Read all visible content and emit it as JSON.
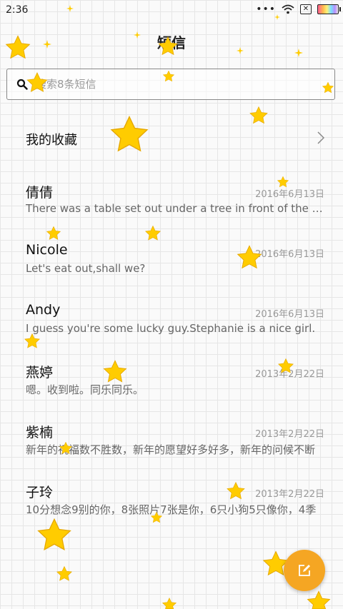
{
  "status_bar": {
    "time": "2:36"
  },
  "title": "短信",
  "search": {
    "placeholder": "搜索8条短信"
  },
  "favorites": {
    "label": "我的收藏"
  },
  "messages": [
    {
      "name": "倩倩",
      "date": "2016年6月13日",
      "preview": "There was a table set out under a tree in front of the house"
    },
    {
      "name": "Nicole",
      "date": "2016年6月13日",
      "preview": "Let's eat out,shall we?"
    },
    {
      "name": "Andy",
      "date": "2016年6月13日",
      "preview": "I guess you're some lucky guy.Stephanie is a nice girl."
    },
    {
      "name": "燕婷",
      "date": "2013年2月22日",
      "preview": "嗯。收到啦。同乐同乐。"
    },
    {
      "name": "紫楠",
      "date": "2013年2月22日",
      "preview": "新年的祝福数不胜数，新年的愿望好多好多，新年的问候不断"
    },
    {
      "name": "子玲",
      "date": "2013年2月22日",
      "preview": "10分想念9别的你，8张照片7张是你，6只小狗5只像你，4季"
    }
  ],
  "colors": {
    "accent": "#f5a623",
    "star": "#ffcc00"
  },
  "icons": {
    "search": "search-icon",
    "chevron": "chevron-right-icon",
    "compose": "compose-icon"
  }
}
